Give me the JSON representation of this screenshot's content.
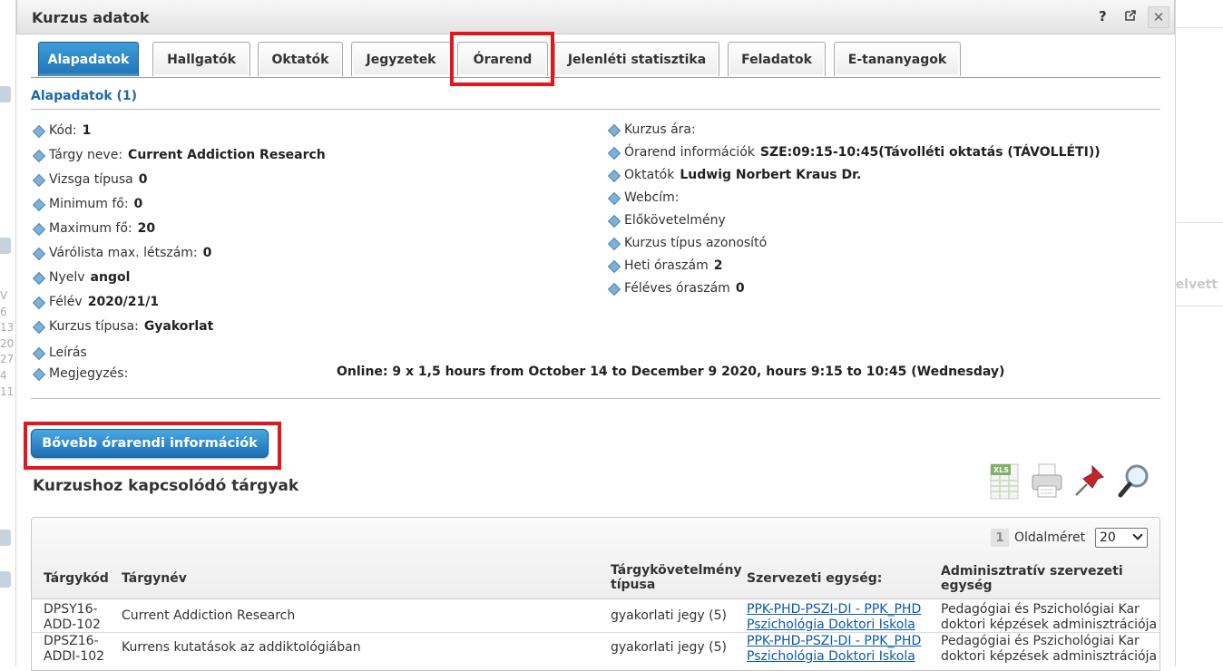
{
  "dialog": {
    "title": "Kurzus adatok",
    "help_icon": "?",
    "close_icon": "✕"
  },
  "tabs": [
    {
      "label": "Alapadatok",
      "active": true
    },
    {
      "label": "Hallgatók"
    },
    {
      "label": "Oktatók"
    },
    {
      "label": "Jegyzetek"
    },
    {
      "label": "Órarend",
      "highlighted": true
    },
    {
      "label": "Jelenléti statisztika"
    },
    {
      "label": "Feladatok"
    },
    {
      "label": "E-tananyagok"
    }
  ],
  "section_title": "Alapadatok (1)",
  "left_fields": [
    {
      "label": "Kód:",
      "value": "1"
    },
    {
      "label": "Tárgy neve:",
      "value": "Current Addiction Research"
    },
    {
      "label": "Vizsga típusa",
      "value": "0"
    },
    {
      "label": "Minimum fő:",
      "value": "0"
    },
    {
      "label": "Maximum fő:",
      "value": "20"
    },
    {
      "label": "Várólista max. létszám:",
      "value": "0"
    },
    {
      "label": "Nyelv",
      "value": "angol"
    },
    {
      "label": "Félév",
      "value": "2020/21/1"
    },
    {
      "label": "Kurzus típusa:",
      "value": "Gyakorlat"
    },
    {
      "label": "Leírás",
      "value": ""
    },
    {
      "label": "Megjegyzés:",
      "value": ""
    }
  ],
  "note_value": "Online: 9 x 1,5 hours from October 14 to December 9 2020, hours 9:15 to 10:45 (Wednesday)",
  "right_fields": [
    {
      "label": "Kurzus ára:",
      "value": ""
    },
    {
      "label": "Órarend információk",
      "value": "SZE:09:15-10:45(Távolléti oktatás (TÁVOLLÉTI))"
    },
    {
      "label": "Oktatók",
      "value": "Ludwig Norbert Kraus Dr."
    },
    {
      "label": "Webcím:",
      "value": ""
    },
    {
      "label": "Előkövetelmény",
      "value": ""
    },
    {
      "label": "Kurzus típus azonosító",
      "value": ""
    },
    {
      "label": "Heti óraszám",
      "value": "2"
    },
    {
      "label": "Féléves óraszám",
      "value": "0"
    }
  ],
  "more_button": "Bővebb órarendi információk",
  "related_title": "Kurzushoz kapcsolódó tárgyak",
  "toolbar_icons": [
    "xls-export-icon",
    "print-icon",
    "pin-icon",
    "search-icon"
  ],
  "xls_label": "XLS",
  "pager": {
    "page": "1",
    "page_size_label": "Oldalméret",
    "page_size": "20"
  },
  "table": {
    "headers": [
      "Tárgykód",
      "Tárgynév",
      "Tárgykövetelmény típusa",
      "Szervezeti egység:",
      "Adminisztratív szervezeti egység"
    ],
    "rows": [
      {
        "code": "DPSY16-ADD-102",
        "name": "Current Addiction Research",
        "req": "gyakorlati jegy (5)",
        "org": "PPK-PHD-PSZI-DI - PPK_PHD Pszichológia Doktori Iskola",
        "admin": "Pedagógiai és Pszichológiai Kar doktori képzések adminisztrációja"
      },
      {
        "code": "DPSZ16-ADDI-102",
        "name": "Kurrens kutatások az addiktológiában",
        "req": "gyakorlati jegy (5)",
        "org": "PPK-PHD-PSZI-DI - PPK_PHD Pszichológia Doktori Iskola",
        "admin": "Pedagógiai és Pszichológiai Kar doktori képzések adminisztrációja"
      }
    ]
  },
  "background": {
    "right_text": "elvett",
    "side_numbers": [
      "V",
      "6",
      "13",
      "20",
      "27",
      "4",
      "11"
    ]
  }
}
